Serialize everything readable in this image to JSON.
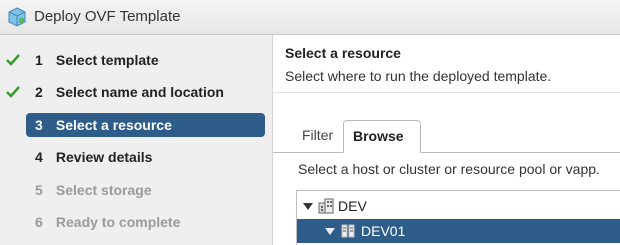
{
  "window": {
    "title": "Deploy OVF Template",
    "icon": "ovf-package-icon"
  },
  "steps": [
    {
      "num": "1",
      "label": "Select template",
      "status": "done"
    },
    {
      "num": "2",
      "label": "Select name and location",
      "status": "done"
    },
    {
      "num": "3",
      "label": "Select a resource",
      "status": "active"
    },
    {
      "num": "4",
      "label": "Review details",
      "status": "pending"
    },
    {
      "num": "5",
      "label": "Select storage",
      "status": "disabled"
    },
    {
      "num": "6",
      "label": "Ready to complete",
      "status": "disabled"
    }
  ],
  "content": {
    "title": "Select a resource",
    "subtitle": "Select where to run the deployed template."
  },
  "tabs": [
    {
      "label": "Filter",
      "selected": false
    },
    {
      "label": "Browse",
      "selected": true
    }
  ],
  "browse": {
    "hint": "Select a host or cluster or resource pool or vapp.",
    "tree": [
      {
        "label": "DEV",
        "icon": "datacenter-icon",
        "expanded": true,
        "selected": false
      },
      {
        "label": "DEV01",
        "icon": "cluster-icon",
        "expanded": true,
        "selected": true
      }
    ]
  },
  "colors": {
    "accent": "#2f5d8a",
    "check": "#3a9a2f",
    "sidebar_bg": "#efefef"
  }
}
